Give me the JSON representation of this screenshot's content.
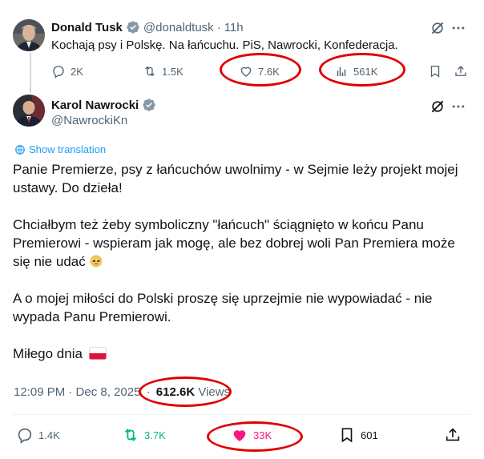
{
  "reply_tweet": {
    "author_name": "Donald Tusk",
    "handle": "@donaldtusk",
    "separator": "·",
    "time": "11h",
    "text": "Kochają psy i Polskę. Na łańcuchu. PiS, Nawrocki, Konfederacja.",
    "actions": {
      "replies": "2K",
      "reposts": "1.5K",
      "likes": "7.6K",
      "views": "561K"
    }
  },
  "main_tweet": {
    "author_name": "Karol Nawrocki",
    "handle": "@NawrockiKn",
    "show_translation": "Show translation",
    "paragraphs": [
      "Panie Premierze, psy z łańcuchów uwolnimy - w Sejmie leży projekt mojej ustawy. Do dzieła!",
      "Chciałbym też żeby symboliczny \"łańcuch\" ściągnięto w końcu Panu Premierowi - wspieram jak mogę, ale bez dobrej woli Pan Premiera może się nie udać",
      "A o mojej miłości do Polski proszę się uprzejmie nie wypowiadać - nie wypada Panu Premierowi.",
      "Miłego dnia"
    ],
    "timestamp": "12:09 PM · Dec 8, 2025",
    "meta_separator": "·",
    "views_count": "612.6K",
    "views_label": "Views",
    "actions": {
      "replies": "1.4K",
      "reposts": "3.7K",
      "likes": "33K",
      "bookmarks": "601"
    }
  },
  "colors": {
    "accent": "#1d9bf0",
    "repost_active": "#00ba7c",
    "like_active": "#f91880",
    "annotation": "#e00000",
    "muted": "#536471"
  },
  "icons": [
    "verified-badge-icon",
    "grok-icon",
    "more-icon",
    "reply-icon",
    "repost-icon",
    "like-icon",
    "views-icon",
    "bookmark-icon",
    "share-icon",
    "globe-icon",
    "pleading-face-emoji",
    "poland-flag-emoji"
  ]
}
